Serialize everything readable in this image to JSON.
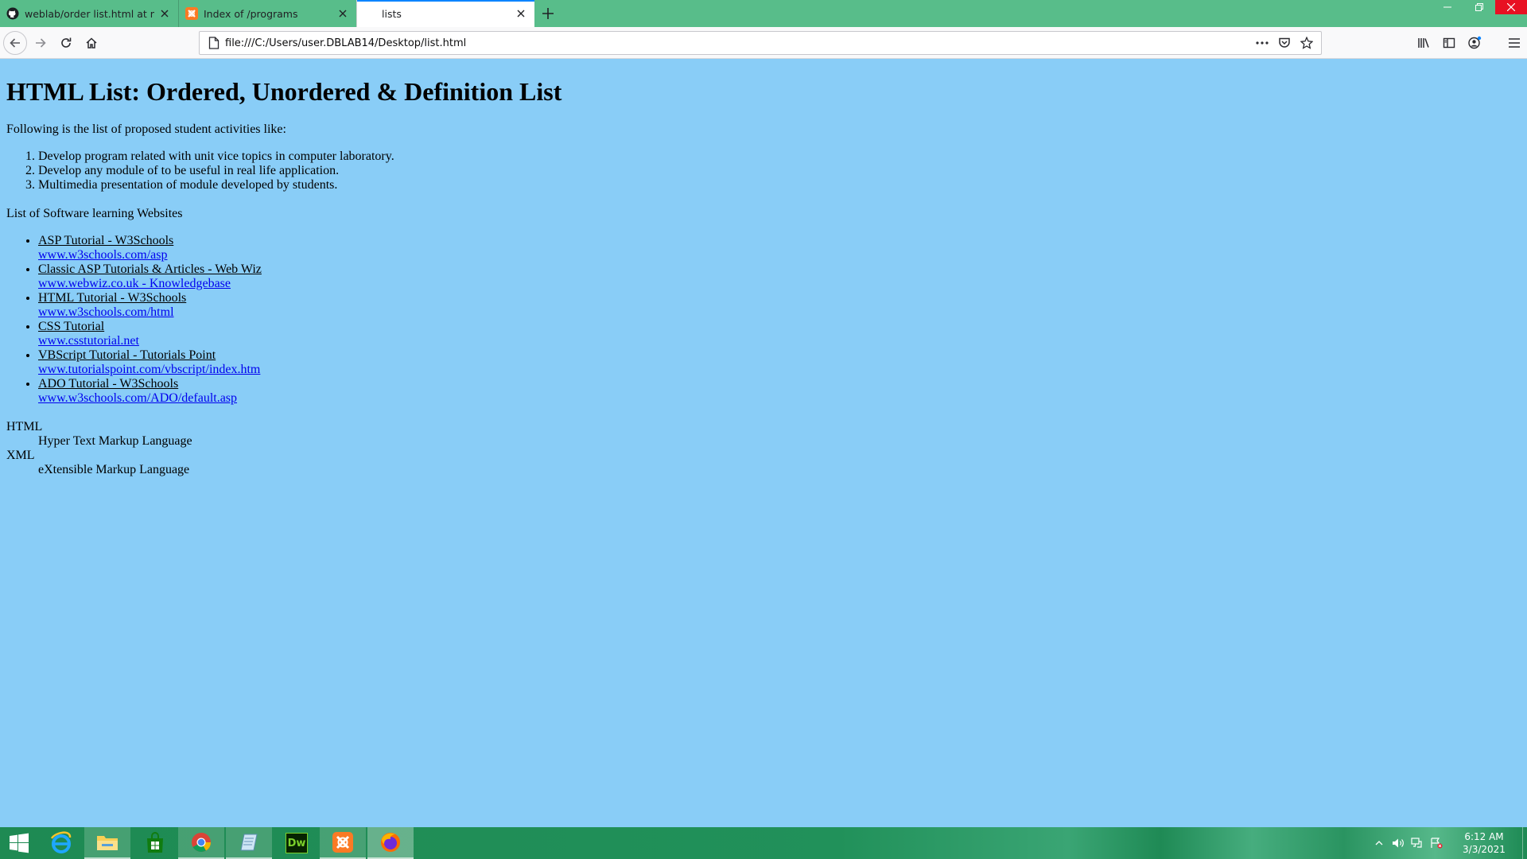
{
  "browser": {
    "tabs": [
      {
        "title": "weblab/order list.html at main",
        "icon": "github-icon",
        "active": false
      },
      {
        "title": "Index of /programs",
        "icon": "xampp-icon",
        "active": false
      },
      {
        "title": "lists",
        "icon": "page-icon",
        "active": true
      }
    ],
    "url": "file:///C:/Users/user.DBLAB14/Desktop/list.html",
    "accent_color": "#58bd8a"
  },
  "page": {
    "background": "#89cdf7",
    "heading": "HTML List: Ordered, Unordered & Definition List",
    "intro": "Following is the list of proposed student activities like:",
    "ordered_items": [
      "Develop program related with unit vice topics in computer laboratory.",
      "Develop any module of to be useful in real life application.",
      "Multimedia presentation of module developed by students."
    ],
    "websites_title": "List of Software learning Websites",
    "websites": [
      {
        "title": "ASP Tutorial - W3Schools",
        "url": "www.w3schools.com/asp"
      },
      {
        "title": "Classic ASP Tutorials & Articles - Web Wiz",
        "url": "www.webwiz.co.uk - Knowledgebase"
      },
      {
        "title": "HTML Tutorial - W3Schools",
        "url": "www.w3schools.com/html"
      },
      {
        "title": "CSS Tutorial",
        "url": "www.csstutorial.net"
      },
      {
        "title": "VBScript Tutorial - Tutorials Point",
        "url": "www.tutorialspoint.com/vbscript/index.htm"
      },
      {
        "title": "ADO Tutorial - W3Schools",
        "url": "www.w3schools.com/ADO/default.asp"
      }
    ],
    "definitions": [
      {
        "term": "HTML",
        "desc": "Hyper Text Markup Language"
      },
      {
        "term": "XML",
        "desc": "eXtensible Markup Language"
      }
    ]
  },
  "taskbar": {
    "apps": [
      "start-icon",
      "internet-explorer-icon",
      "file-explorer-icon",
      "store-icon",
      "chrome-icon",
      "notepad-icon",
      "dreamweaver-icon",
      "xampp-icon",
      "firefox-icon"
    ],
    "dreamweaver_label": "Dw",
    "time": "6:12 AM",
    "date": "3/3/2021"
  }
}
